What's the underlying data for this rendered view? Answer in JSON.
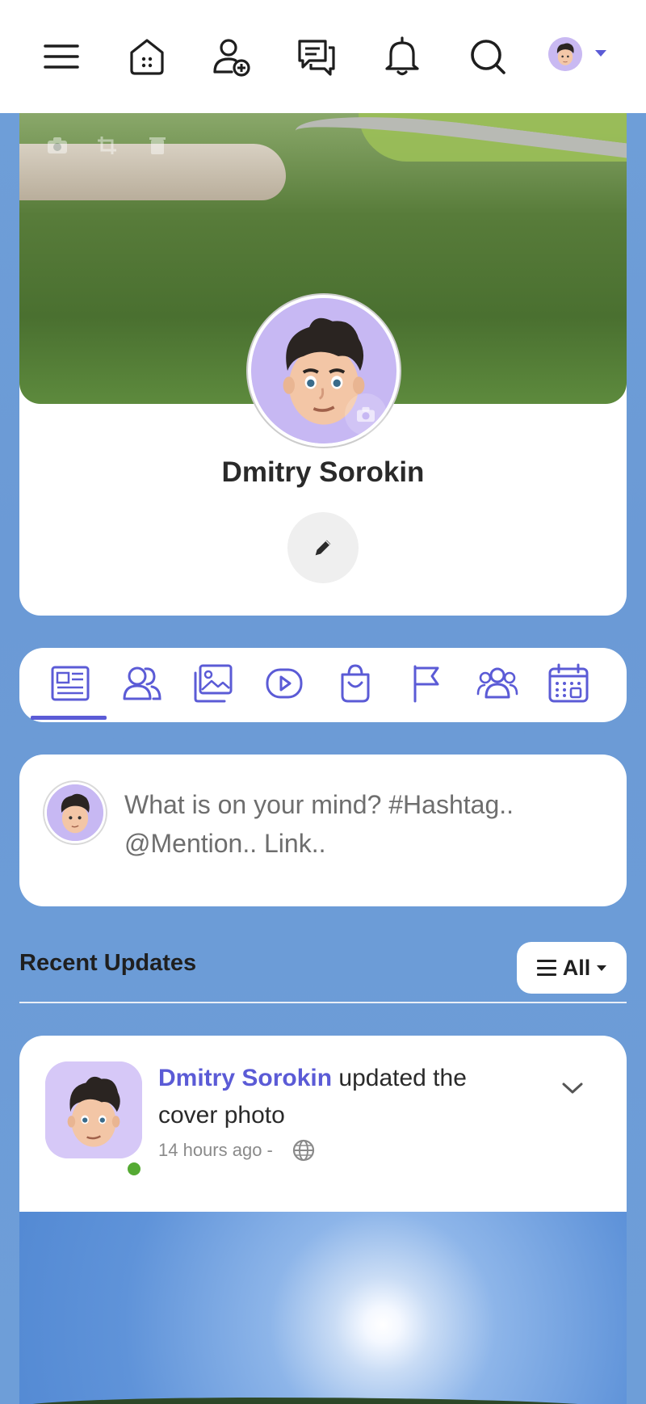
{
  "nav": {
    "icons": [
      "menu-icon",
      "home-icon",
      "add-friend-icon",
      "messages-icon",
      "notifications-icon",
      "search-icon"
    ],
    "accent": "#5b5bd6"
  },
  "profile": {
    "name": "Dmitry Sorokin"
  },
  "tabs": {
    "items": [
      "timeline",
      "friends",
      "photos",
      "videos",
      "shop",
      "pages",
      "groups",
      "events"
    ],
    "active": "timeline"
  },
  "composer": {
    "placeholder": "What is on your mind? #Hashtag.. @Mention.. Link.."
  },
  "feed": {
    "title": "Recent Updates",
    "filter_label": "All"
  },
  "post": {
    "author": "Dmitry Sorokin",
    "action": "updated the cover photo",
    "time": "14 hours ago -",
    "status_color": "#55aa33"
  }
}
